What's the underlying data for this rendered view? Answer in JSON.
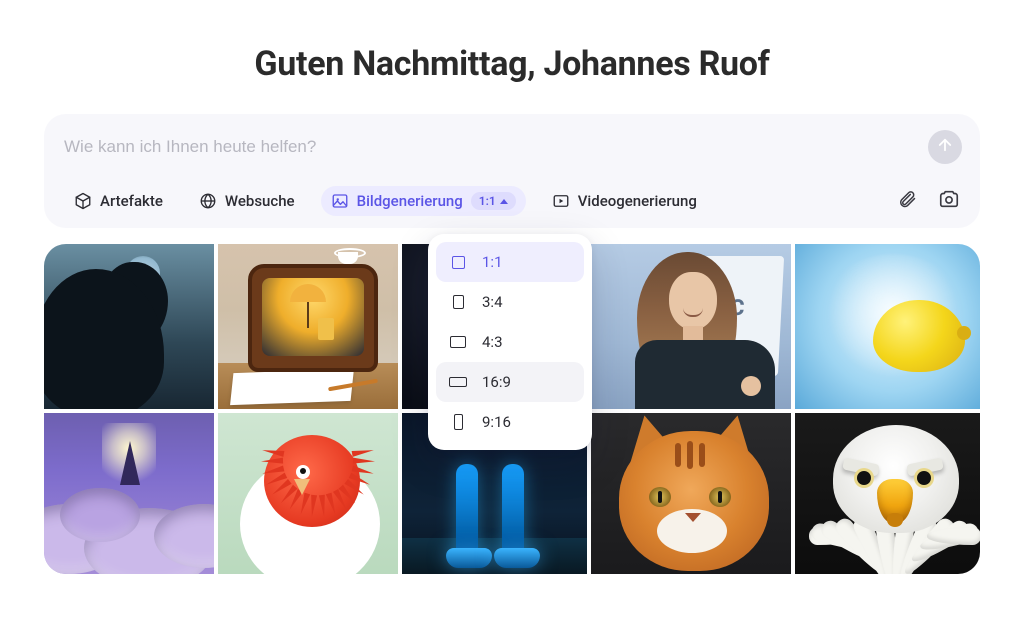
{
  "greeting": "Guten Nachmittag, Johannes Ruof",
  "prompt": {
    "placeholder": "Wie kann ich Ihnen heute helfen?"
  },
  "tools": {
    "artifacts": "Artefakte",
    "websearch": "Websuche",
    "image_gen": "Bildgenerierung",
    "image_gen_ratio_badge": "1:1",
    "video_gen": "Videogenerierung"
  },
  "aspect_ratio_options": {
    "o1": "1:1",
    "o2": "3:4",
    "o3": "4:3",
    "o4": "16:9",
    "o5": "9:16"
  },
  "panel_text": "ASC",
  "colors": {
    "accent": "#5b55e6",
    "accent_bg": "#ecebff",
    "badge_bg": "#dedcfd",
    "surface": "#f7f7fb"
  }
}
